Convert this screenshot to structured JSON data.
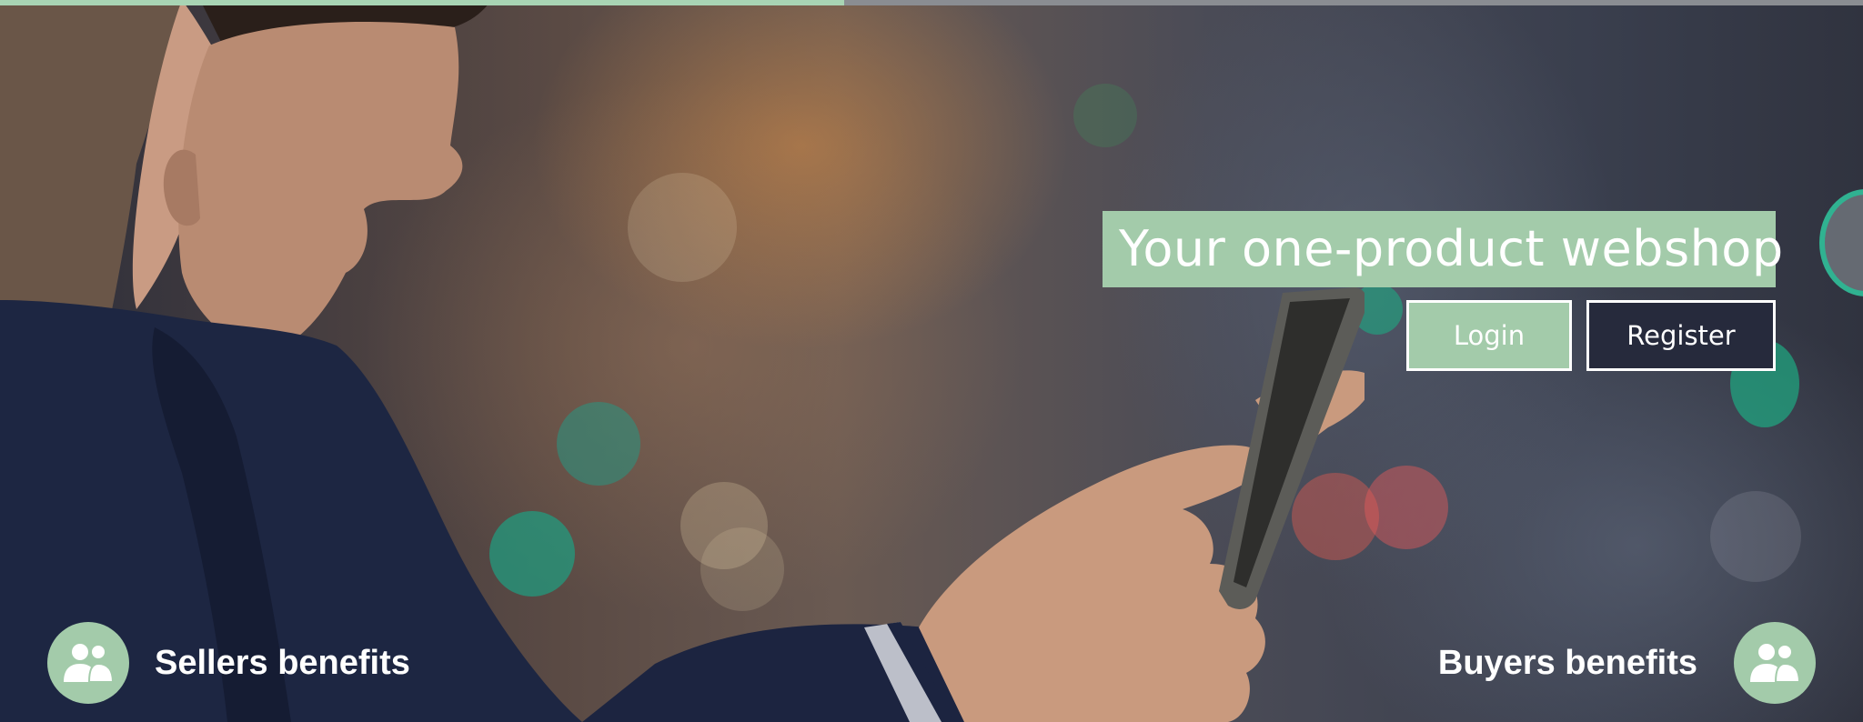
{
  "progress": {
    "value": 0.453
  },
  "hero": {
    "headline": "Your one-product webshop",
    "login_label": "Login",
    "register_label": "Register"
  },
  "benefits": {
    "sellers_label": "Sellers benefits",
    "buyers_label": "Buyers benefits"
  },
  "icons": {
    "sellers": "users-icon",
    "buyers": "users-icon"
  },
  "colors": {
    "accent": "#a3cbaa",
    "dark_button": "#262a3c",
    "text": "#ffffff"
  }
}
